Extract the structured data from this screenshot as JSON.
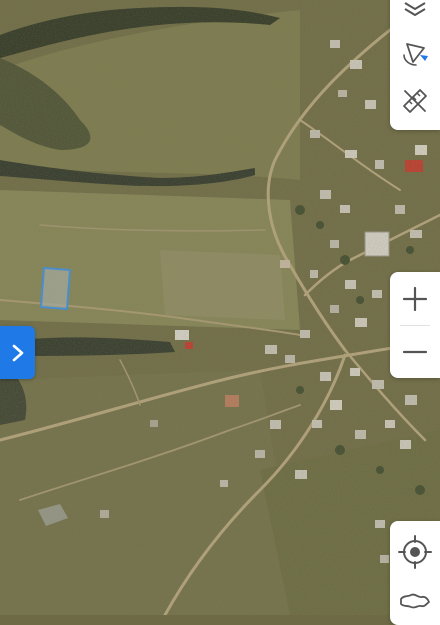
{
  "map": {
    "view": "satellite",
    "selection_color": "#3d8fe0",
    "colors": {
      "base": "#6d6a45",
      "field_light": "#8a8a55",
      "ravine": "#2e3524",
      "road": "#b9a57a",
      "rooftop": "#c6c2b6",
      "accent_roof": "#c0392b"
    }
  },
  "controls": {
    "icons": {
      "layers": "layers-icon",
      "compass": "compass-icon",
      "measure": "ruler-pencil-icon",
      "zoom_in": "plus-icon",
      "zoom_out": "minus-icon",
      "locate": "crosshair-icon",
      "map_outline": "map-outline-icon",
      "panel_toggle": "chevron-right-icon"
    },
    "button_bg": "#ffffff",
    "icon_color": "#555555",
    "toggle_color": "#1f7ae8",
    "compass_accent": "#1f7ae8"
  }
}
